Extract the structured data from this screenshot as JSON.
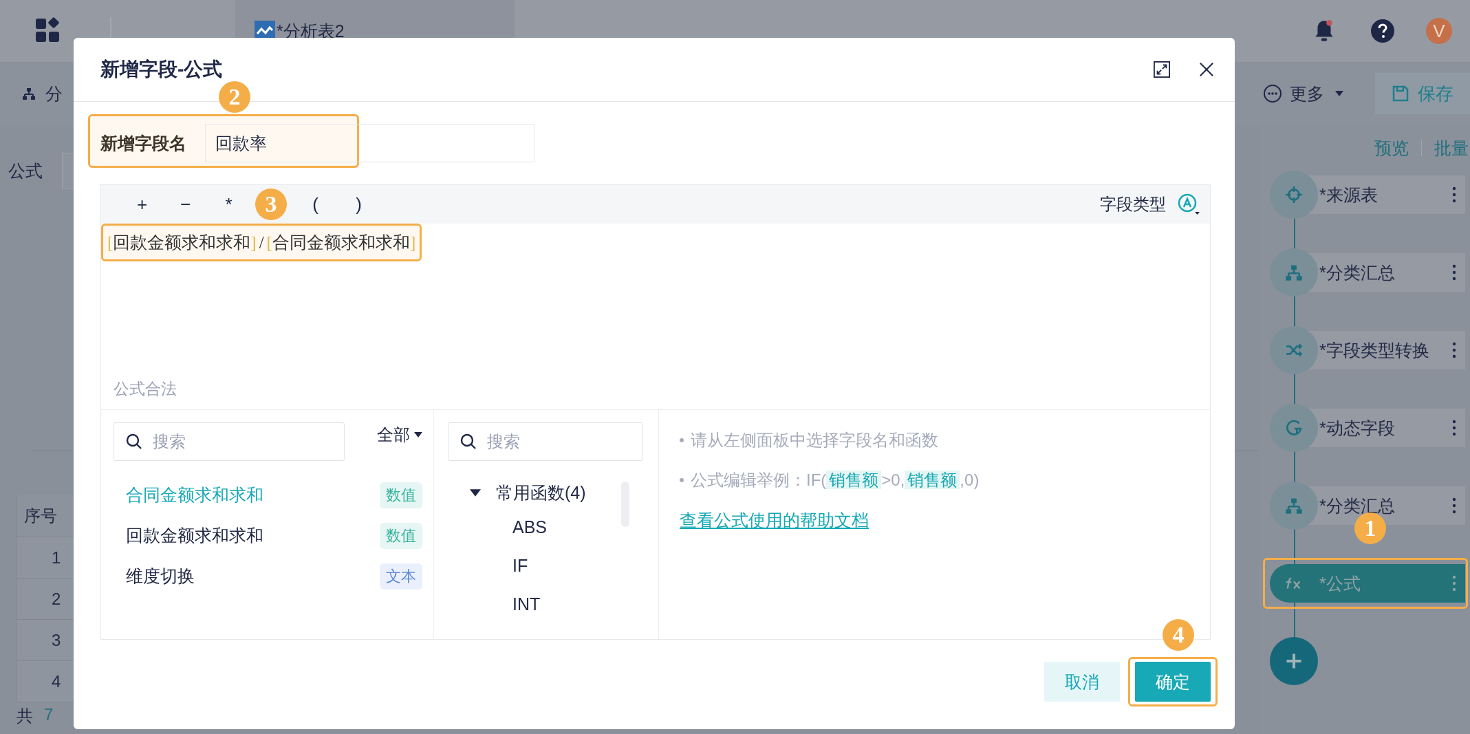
{
  "top_bar": {
    "tab": {
      "title": "*分析表2"
    },
    "avatar": "V"
  },
  "toolbar": {
    "left_label": "分",
    "more": "更多",
    "save": "保存"
  },
  "background": {
    "formula_label": "公式",
    "table": {
      "columns": [
        "序号"
      ],
      "rows": [
        "1",
        "2",
        "3",
        "4"
      ]
    },
    "footer": {
      "prefix": "共",
      "count": "7"
    }
  },
  "sidebar": {
    "actions": [
      "预览",
      "批量"
    ],
    "steps": [
      {
        "kind": "source",
        "name": "*来源表",
        "selected": false
      },
      {
        "kind": "group",
        "name": "*分类汇总",
        "selected": false
      },
      {
        "kind": "convert",
        "name": "*字段类型转换",
        "selected": false
      },
      {
        "kind": "dynamic",
        "name": "*动态字段",
        "selected": false
      },
      {
        "kind": "group",
        "name": "*分类汇总",
        "selected": false
      },
      {
        "kind": "formula",
        "name": "*公式",
        "selected": true,
        "callout": "1"
      }
    ]
  },
  "dialog": {
    "title": "新增字段-公式",
    "name_field": {
      "label": "新增字段名",
      "value": "回款率",
      "callout": "2"
    },
    "editor": {
      "operators": [
        "+",
        "−",
        "*",
        "(",
        ")"
      ],
      "type_label": "字段类型",
      "callout": "3",
      "formula": [
        {
          "kind": "field",
          "open": "[",
          "name": "回款金额求和求和",
          "close": "]"
        },
        {
          "kind": "operator",
          "text": "/"
        },
        {
          "kind": "field",
          "open": "[",
          "name": "合同金额求和求和",
          "close": "]"
        }
      ],
      "status": "公式合法"
    },
    "fields_panel": {
      "search_placeholder": "搜索",
      "filter": "全部",
      "items": [
        {
          "name": "合同金额求和求和",
          "type": "数值",
          "kind": "number",
          "selected": true
        },
        {
          "name": "回款金额求和求和",
          "type": "数值",
          "kind": "number",
          "selected": false
        },
        {
          "name": "维度切换",
          "type": "文本",
          "kind": "text",
          "selected": false
        }
      ]
    },
    "functions_panel": {
      "search_placeholder": "搜索",
      "groups": [
        {
          "name": "常用函数(4)",
          "expanded": true,
          "children": [
            {
              "name": "ABS"
            },
            {
              "name": "IF"
            },
            {
              "name": "INT"
            }
          ]
        }
      ]
    },
    "help": {
      "hint": "请从左侧面板中选择字段名和函数",
      "example": [
        {
          "kind": "text",
          "text": "公式编辑举例：IF("
        },
        {
          "kind": "field",
          "text": "销售额"
        },
        {
          "kind": "text",
          "text": ">0,"
        },
        {
          "kind": "field",
          "text": "销售额"
        },
        {
          "kind": "text",
          "text": ",0)"
        }
      ],
      "link": "查看公式使用的帮助文档"
    },
    "buttons": [
      {
        "label": "取消",
        "kind": "secondary"
      },
      {
        "label": "确定",
        "kind": "primary",
        "callout": "4"
      }
    ]
  }
}
